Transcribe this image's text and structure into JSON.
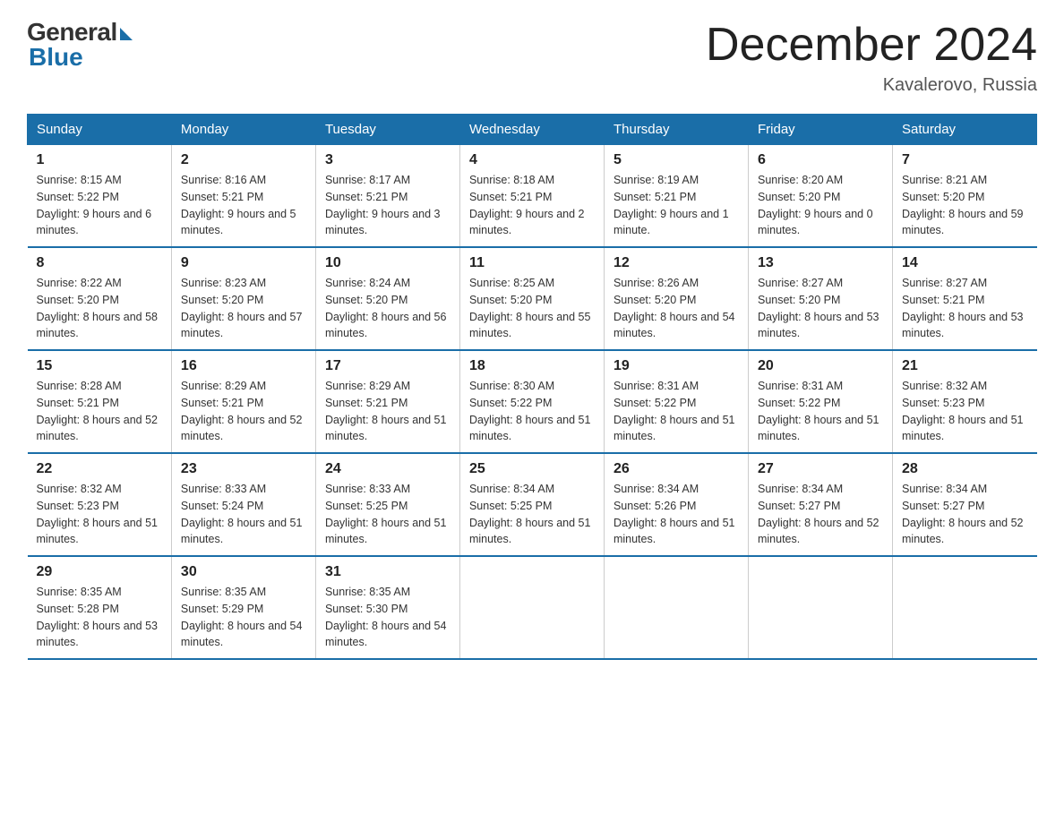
{
  "header": {
    "logo_general": "General",
    "logo_blue": "Blue",
    "month_title": "December 2024",
    "location": "Kavalerovo, Russia"
  },
  "days_of_week": [
    "Sunday",
    "Monday",
    "Tuesday",
    "Wednesday",
    "Thursday",
    "Friday",
    "Saturday"
  ],
  "weeks": [
    [
      {
        "day": "1",
        "sunrise": "8:15 AM",
        "sunset": "5:22 PM",
        "daylight": "9 hours and 6 minutes."
      },
      {
        "day": "2",
        "sunrise": "8:16 AM",
        "sunset": "5:21 PM",
        "daylight": "9 hours and 5 minutes."
      },
      {
        "day": "3",
        "sunrise": "8:17 AM",
        "sunset": "5:21 PM",
        "daylight": "9 hours and 3 minutes."
      },
      {
        "day": "4",
        "sunrise": "8:18 AM",
        "sunset": "5:21 PM",
        "daylight": "9 hours and 2 minutes."
      },
      {
        "day": "5",
        "sunrise": "8:19 AM",
        "sunset": "5:21 PM",
        "daylight": "9 hours and 1 minute."
      },
      {
        "day": "6",
        "sunrise": "8:20 AM",
        "sunset": "5:20 PM",
        "daylight": "9 hours and 0 minutes."
      },
      {
        "day": "7",
        "sunrise": "8:21 AM",
        "sunset": "5:20 PM",
        "daylight": "8 hours and 59 minutes."
      }
    ],
    [
      {
        "day": "8",
        "sunrise": "8:22 AM",
        "sunset": "5:20 PM",
        "daylight": "8 hours and 58 minutes."
      },
      {
        "day": "9",
        "sunrise": "8:23 AM",
        "sunset": "5:20 PM",
        "daylight": "8 hours and 57 minutes."
      },
      {
        "day": "10",
        "sunrise": "8:24 AM",
        "sunset": "5:20 PM",
        "daylight": "8 hours and 56 minutes."
      },
      {
        "day": "11",
        "sunrise": "8:25 AM",
        "sunset": "5:20 PM",
        "daylight": "8 hours and 55 minutes."
      },
      {
        "day": "12",
        "sunrise": "8:26 AM",
        "sunset": "5:20 PM",
        "daylight": "8 hours and 54 minutes."
      },
      {
        "day": "13",
        "sunrise": "8:27 AM",
        "sunset": "5:20 PM",
        "daylight": "8 hours and 53 minutes."
      },
      {
        "day": "14",
        "sunrise": "8:27 AM",
        "sunset": "5:21 PM",
        "daylight": "8 hours and 53 minutes."
      }
    ],
    [
      {
        "day": "15",
        "sunrise": "8:28 AM",
        "sunset": "5:21 PM",
        "daylight": "8 hours and 52 minutes."
      },
      {
        "day": "16",
        "sunrise": "8:29 AM",
        "sunset": "5:21 PM",
        "daylight": "8 hours and 52 minutes."
      },
      {
        "day": "17",
        "sunrise": "8:29 AM",
        "sunset": "5:21 PM",
        "daylight": "8 hours and 51 minutes."
      },
      {
        "day": "18",
        "sunrise": "8:30 AM",
        "sunset": "5:22 PM",
        "daylight": "8 hours and 51 minutes."
      },
      {
        "day": "19",
        "sunrise": "8:31 AM",
        "sunset": "5:22 PM",
        "daylight": "8 hours and 51 minutes."
      },
      {
        "day": "20",
        "sunrise": "8:31 AM",
        "sunset": "5:22 PM",
        "daylight": "8 hours and 51 minutes."
      },
      {
        "day": "21",
        "sunrise": "8:32 AM",
        "sunset": "5:23 PM",
        "daylight": "8 hours and 51 minutes."
      }
    ],
    [
      {
        "day": "22",
        "sunrise": "8:32 AM",
        "sunset": "5:23 PM",
        "daylight": "8 hours and 51 minutes."
      },
      {
        "day": "23",
        "sunrise": "8:33 AM",
        "sunset": "5:24 PM",
        "daylight": "8 hours and 51 minutes."
      },
      {
        "day": "24",
        "sunrise": "8:33 AM",
        "sunset": "5:25 PM",
        "daylight": "8 hours and 51 minutes."
      },
      {
        "day": "25",
        "sunrise": "8:34 AM",
        "sunset": "5:25 PM",
        "daylight": "8 hours and 51 minutes."
      },
      {
        "day": "26",
        "sunrise": "8:34 AM",
        "sunset": "5:26 PM",
        "daylight": "8 hours and 51 minutes."
      },
      {
        "day": "27",
        "sunrise": "8:34 AM",
        "sunset": "5:27 PM",
        "daylight": "8 hours and 52 minutes."
      },
      {
        "day": "28",
        "sunrise": "8:34 AM",
        "sunset": "5:27 PM",
        "daylight": "8 hours and 52 minutes."
      }
    ],
    [
      {
        "day": "29",
        "sunrise": "8:35 AM",
        "sunset": "5:28 PM",
        "daylight": "8 hours and 53 minutes."
      },
      {
        "day": "30",
        "sunrise": "8:35 AM",
        "sunset": "5:29 PM",
        "daylight": "8 hours and 54 minutes."
      },
      {
        "day": "31",
        "sunrise": "8:35 AM",
        "sunset": "5:30 PM",
        "daylight": "8 hours and 54 minutes."
      },
      null,
      null,
      null,
      null
    ]
  ],
  "labels": {
    "sunrise": "Sunrise:",
    "sunset": "Sunset:",
    "daylight": "Daylight:"
  }
}
